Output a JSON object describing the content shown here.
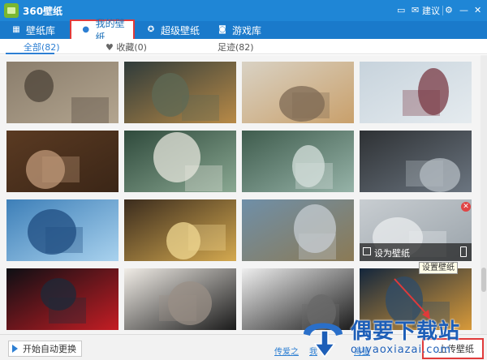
{
  "window": {
    "title": "360壁纸",
    "feedback_label": "建议"
  },
  "tabs": [
    {
      "label": "壁纸库",
      "icon": "grid-icon"
    },
    {
      "label": "我的壁纸",
      "icon": "user-icon"
    },
    {
      "label": "超级壁纸",
      "icon": "star-icon"
    },
    {
      "label": "游戏库",
      "icon": "gamepad-icon"
    }
  ],
  "filters": {
    "all": "全部(82)",
    "favorites": "收藏(0)",
    "footprints": "足迹(82)"
  },
  "thumbnails": [
    {
      "name": "cats",
      "palette": [
        "#8a7d6c",
        "#b3a58f",
        "#4c4338"
      ]
    },
    {
      "name": "lions",
      "palette": [
        "#2f3b3a",
        "#b88a47",
        "#5e6a55"
      ]
    },
    {
      "name": "costume-warrior",
      "palette": [
        "#d9d2c4",
        "#c9a06b",
        "#7d6a54"
      ]
    },
    {
      "name": "snow-girl",
      "palette": [
        "#c7d3dc",
        "#e5ebef",
        "#7a3a44"
      ]
    },
    {
      "name": "man-in-doorway",
      "palette": [
        "#5a3a22",
        "#3b2617",
        "#c09a7a"
      ]
    },
    {
      "name": "bamboo-girl",
      "palette": [
        "#2f4a3c",
        "#8aa892",
        "#e6e6dc"
      ]
    },
    {
      "name": "fairy-girl",
      "palette": [
        "#3f5c4d",
        "#96b3a8",
        "#d6e0dc"
      ]
    },
    {
      "name": "man-in-car",
      "palette": [
        "#2e3134",
        "#6b7580",
        "#b4bcc3"
      ]
    },
    {
      "name": "mountain-lake",
      "palette": [
        "#3d7fb8",
        "#a9d2ee",
        "#1f4c80"
      ]
    },
    {
      "name": "cartoon-block",
      "palette": [
        "#3b2c1e",
        "#d4a94f",
        "#f0d892"
      ]
    },
    {
      "name": "valley",
      "palette": [
        "#6f8fa8",
        "#8b7a55",
        "#c5ccd2"
      ]
    },
    {
      "name": "misty-lake",
      "palette": [
        "#c8cdd1",
        "#9aa3aa",
        "#e9ecee"
      ]
    },
    {
      "name": "red-spider",
      "palette": [
        "#0d0f14",
        "#c41d24",
        "#1c2a3a"
      ]
    },
    {
      "name": "ink-warrior",
      "palette": [
        "#f0ece6",
        "#1a1a1a",
        "#9a8f86"
      ]
    },
    {
      "name": "jax-surprise",
      "palette": [
        "#eeeeee",
        "#1b1b1b",
        "#6a6a6a"
      ]
    },
    {
      "name": "night-street",
      "palette": [
        "#13263c",
        "#d89a3a",
        "#2f4c6a"
      ]
    }
  ],
  "hover_overlay": {
    "set_label": "设为壁纸",
    "delete_icon": "close-icon"
  },
  "tooltip": "设置壁纸",
  "bottom": {
    "auto_change_label": "开始自动更换",
    "link1": "传爱之",
    "link2": "我",
    "link3": "海量",
    "upload_label": "上传壁纸"
  },
  "watermark": {
    "title": "偶要下载站",
    "url": "ouyaoxiazai.com"
  },
  "colors": {
    "titlebar": "#1f86d6",
    "tabbar": "#1a7acb",
    "accent": "#2d7fd3",
    "highlight_border": "#e03a3a"
  }
}
